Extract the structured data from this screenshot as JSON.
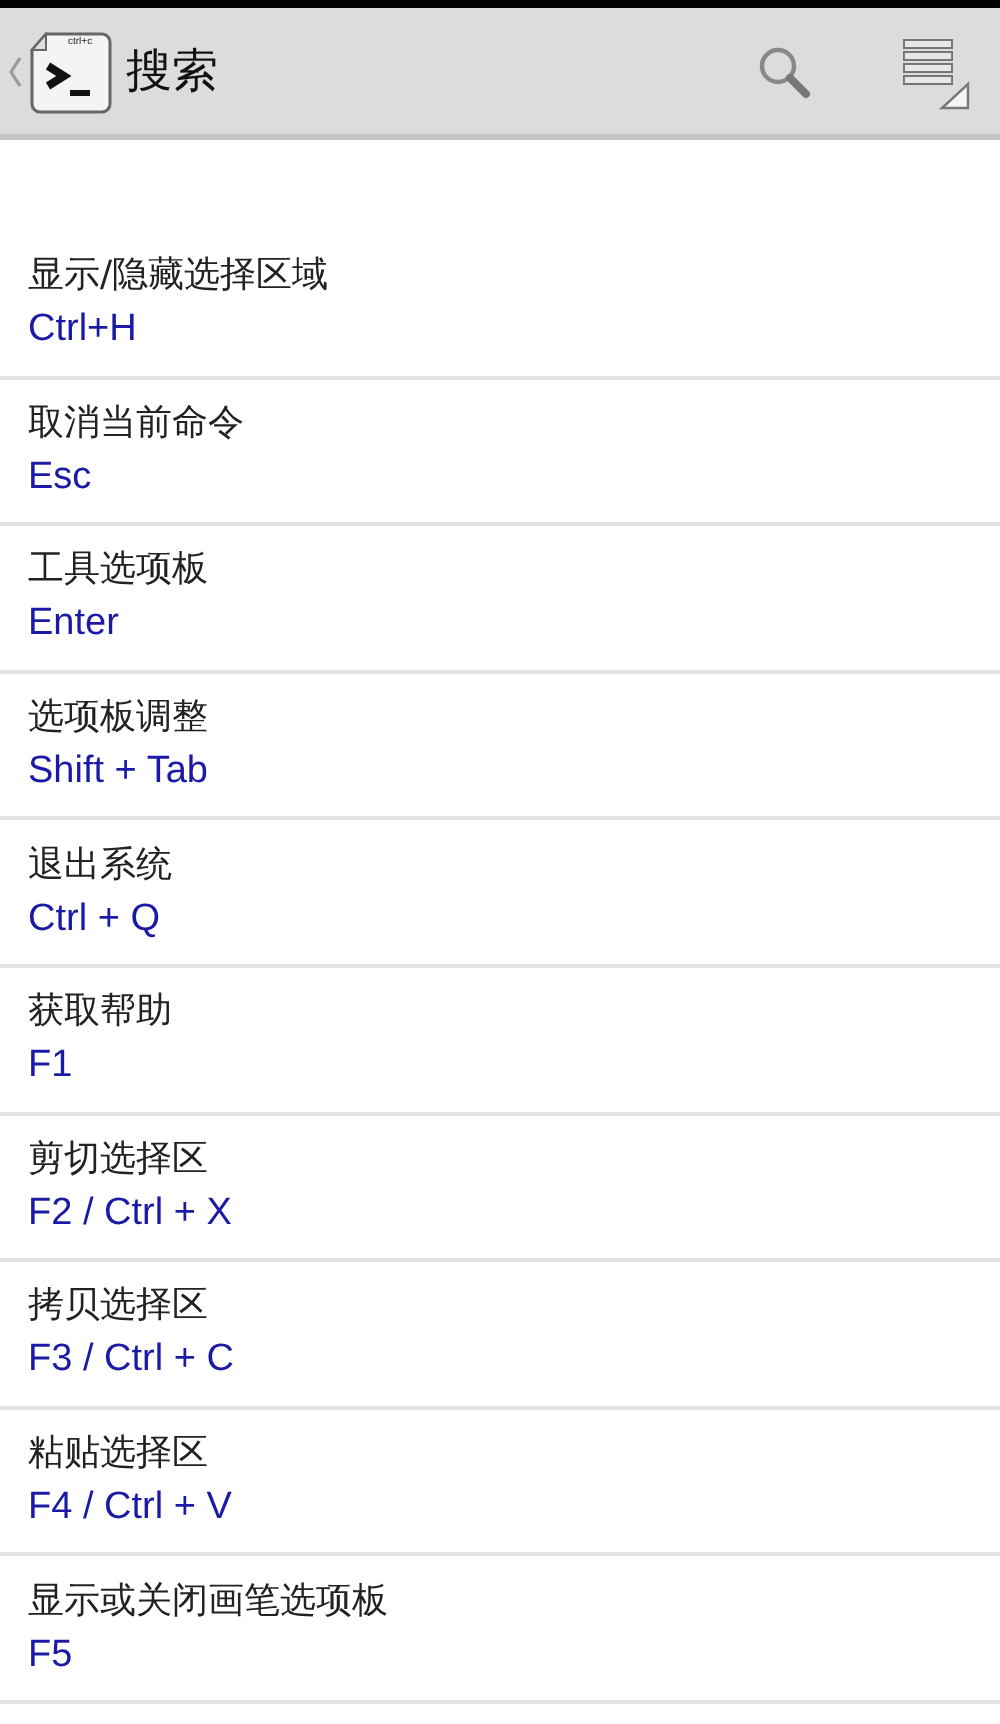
{
  "action_bar": {
    "app_icon_text": "ctrl+c",
    "title": "搜索"
  },
  "shortcuts": [
    {
      "name": "显示/隐藏选择区域",
      "keys": "Ctrl+H"
    },
    {
      "name": "取消当前命令",
      "keys": "Esc"
    },
    {
      "name": "工具选项板",
      "keys": "Enter"
    },
    {
      "name": "选项板调整",
      "keys": "Shift + Tab"
    },
    {
      "name": "退出系统",
      "keys": "Ctrl + Q"
    },
    {
      "name": "获取帮助",
      "keys": "F1"
    },
    {
      "name": "剪切选择区",
      "keys": "F2 / Ctrl + X"
    },
    {
      "name": "拷贝选择区",
      "keys": "F3 / Ctrl + C"
    },
    {
      "name": "粘贴选择区",
      "keys": "F4 / Ctrl + V"
    },
    {
      "name": "显示或关闭画笔选项板",
      "keys": "F5"
    }
  ]
}
